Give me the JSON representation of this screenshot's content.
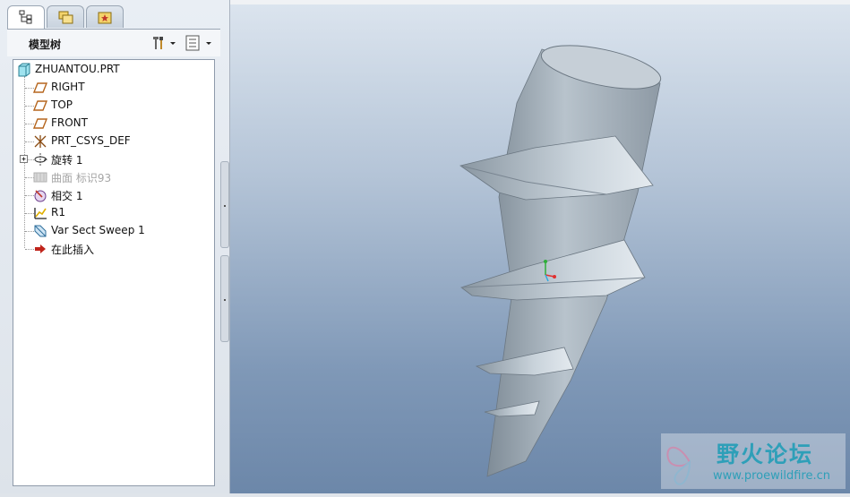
{
  "panel": {
    "title": "模型树",
    "tabs": [
      {
        "icon": "model-tree-icon"
      },
      {
        "icon": "folder-browser-icon"
      },
      {
        "icon": "favorites-icon"
      }
    ],
    "header_buttons": [
      {
        "icon": "settings-icon",
        "dropdown": true
      },
      {
        "icon": "show-icon",
        "dropdown": true
      }
    ]
  },
  "tree": {
    "root": {
      "label": "ZHUANTOU.PRT",
      "icon": "part-icon"
    },
    "items": [
      {
        "label": "RIGHT",
        "icon": "datum-plane-icon"
      },
      {
        "label": "TOP",
        "icon": "datum-plane-icon"
      },
      {
        "label": "FRONT",
        "icon": "datum-plane-icon"
      },
      {
        "label": "PRT_CSYS_DEF",
        "icon": "csys-icon"
      },
      {
        "label": "旋转 1",
        "icon": "revolve-icon",
        "expandable": true
      },
      {
        "label": "曲面 标识93",
        "icon": "surface-icon",
        "disabled": true
      },
      {
        "label": "相交 1",
        "icon": "intersect-icon"
      },
      {
        "label": "R1",
        "icon": "sketch-icon"
      },
      {
        "label": "Var Sect Sweep 1",
        "icon": "sweep-icon"
      },
      {
        "label": "在此插入",
        "icon": "insert-here-arrow-icon"
      }
    ]
  },
  "viewport": {
    "model": "drill-screw-3d-model",
    "colors": {
      "background_top": "#dbe4ee",
      "background_bottom": "#6c87a9",
      "model": "#aab6c0"
    }
  },
  "watermark": {
    "title": "野火论坛",
    "url": "www.proewildfire.cn"
  }
}
